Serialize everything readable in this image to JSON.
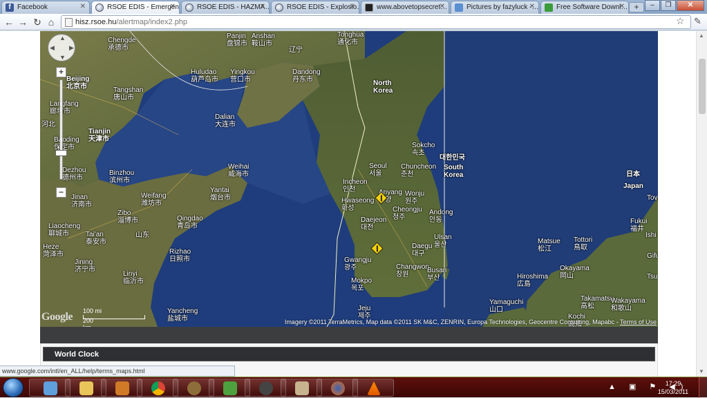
{
  "tabs": [
    {
      "label": "Facebook",
      "icon": "facebook-icon",
      "active": false
    },
    {
      "label": "RSOE EDIS - Emergen…",
      "icon": "globe-icon",
      "active": true
    },
    {
      "label": "RSOE EDIS - HAZMA…",
      "icon": "globe-icon",
      "active": false
    },
    {
      "label": "RSOE EDIS - Explosio…",
      "icon": "globe-icon",
      "active": false
    },
    {
      "label": "www.abovetopsecret…",
      "icon": "ats-icon",
      "active": false
    },
    {
      "label": "Pictures by fazyluck -…",
      "icon": "photobucket-icon",
      "active": false
    },
    {
      "label": "Free Software Downl…",
      "icon": "download-icon",
      "active": false
    }
  ],
  "toolbar": {
    "url_host": "hisz.rsoe.hu",
    "url_path": "/alertmap/index2.php"
  },
  "map": {
    "labels": {
      "chengde": "Chengde\n承德市",
      "panjin": "Panjin\n盘锦市",
      "anshan": "Anshan\n鞍山市",
      "tonghua": "Tonghua\n通化市",
      "beijing": "Beijing\n北京市",
      "huludao": "Huludao\n葫芦岛市",
      "yingkou": "Yingkou\n营口市",
      "liaoning": "辽宁",
      "dandong": "Dandong\n丹东市",
      "tangshan": "Tangshan\n唐山市",
      "langfang": "Langfang\n廊坊市",
      "hebei": "河北",
      "tianjin": "Tianjin\n天津市",
      "dalian": "Dalian\n大连市",
      "north_korea": "North\nKorea",
      "baoding": "Baoding\n保定市",
      "sokcho": "Sokcho\n속초",
      "south_korea_ko": "대한민국",
      "south_korea": "South\nKorea",
      "dezhou": "Dezhou\n德州市",
      "binzhou": "Binzhou\n滨州市",
      "weihai": "Weihai\n威海市",
      "seoul": "Seoul\n서울",
      "chuncheon": "Chuncheon\n춘천",
      "incheon": "Incheon\n인천",
      "wonju": "Wonju\n원주",
      "jinan": "Jinan\n济南市",
      "weifang": "Weifang\n潍坊市",
      "yantai": "Yantai\n烟台市",
      "hwaseong": "Hwaseong\n화성",
      "anyang": "Anyang\n안양",
      "cheongju": "Cheongju\n청주",
      "japan_ja": "日本",
      "japan": "Japan",
      "zibo": "Zibo\n淄博市",
      "qingdao": "Qingdao\n青岛市",
      "daejeon": "Daejeon\n대전",
      "andong": "Andong\n안동",
      "liaocheng": "Liaocheng\n聊城市",
      "shandong": "山东",
      "taian": "Tai'an\n泰安市",
      "fukui": "Fukui\n福井",
      "heze": "Heze\n菏泽市",
      "rizhao": "Rizhao\n日照市",
      "daegu": "Daegu\n대구",
      "ulsan": "Ulsan\n울산",
      "tottori": "Tottori\n鳥取",
      "matsue": "Matsue\n松江",
      "jining": "Jining\n济宁市",
      "linyi": "Linyi\n临沂市",
      "gwangju": "Gwangju\n광주",
      "changwon": "Changwon\n창원",
      "busan": "Busan\n부산",
      "hiroshima": "Hiroshima\n広島",
      "okayama": "Okayama\n岡山",
      "mokpo": "Mokpo\n목포",
      "yamaguchi": "Yamaguchi\n山口",
      "takamatsu": "Takamatsu\n高松",
      "wakayama": "Wakayama\n和歌山",
      "yancheng": "Yancheng\n盐城市",
      "jeju": "Jeju\n제주",
      "kochi": "Kochi\n高知",
      "tova": "Tova",
      "ishi": "Ishi",
      "gifu": "Gifu",
      "tsu": "Tsu"
    },
    "scale_mi": "100 mi",
    "scale_km": "200 km",
    "logo": "Google",
    "attribution": "Imagery ©2011 TerraMetrics, Map data ©2011 SK M&C, ZENRIN, Europa Technologies, Geocentre Consulting, Mapabc",
    "terms": "Terms of Use"
  },
  "section": {
    "world_clock": "World Clock"
  },
  "status": "www.google.com/intl/en_ALL/help/terms_maps.html",
  "taskbar": {
    "time": "17:29",
    "date": "15/03/2011",
    "apps": [
      "windows-explorer-icon",
      "folder-icon",
      "media-player-icon",
      "chrome-icon",
      "tor-icon",
      "messenger-icon",
      "steam-icon",
      "paint-icon",
      "firefox-icon",
      "vlc-icon"
    ]
  },
  "colors": {
    "sea": "#1f3f7e",
    "land": "#5e6a3c",
    "taskbar": "#4a0b08"
  }
}
